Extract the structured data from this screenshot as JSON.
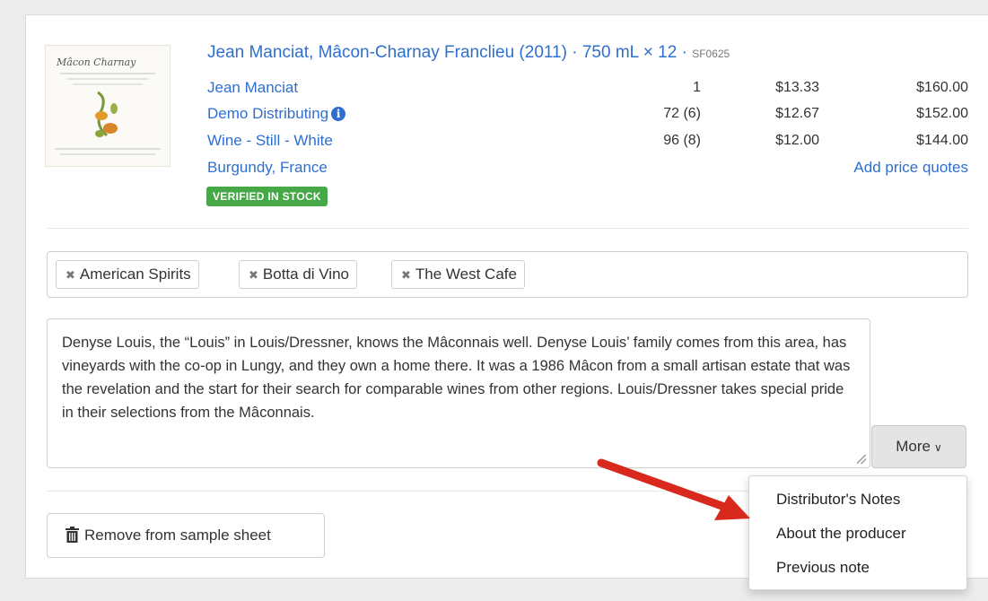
{
  "product": {
    "title": "Jean Manciat, Mâcon-Charnay Franclieu (2011) · 750 mL × 12 · ",
    "sku": "SF0625",
    "producer": "Jean Manciat",
    "distributor": "Demo Distributing",
    "category": "Wine - Still - White",
    "region": "Burgundy, France",
    "badge": "VERIFIED IN STOCK",
    "label_image_text": "Mâcon Charnay"
  },
  "pricing": {
    "rows": [
      {
        "qty": "1",
        "unit": "$13.33",
        "case": "$160.00"
      },
      {
        "qty": "72 (6)",
        "unit": "$12.67",
        "case": "$152.00"
      },
      {
        "qty": "96 (8)",
        "unit": "$12.00",
        "case": "$144.00"
      }
    ],
    "add_quotes_label": "Add price quotes"
  },
  "tags": [
    {
      "label": "American Spirits"
    },
    {
      "label": "Botta di Vino"
    },
    {
      "label": "The West Cafe"
    }
  ],
  "notes": {
    "text": "Denyse Louis, the “Louis” in Louis/Dressner, knows the Mâconnais well. Denyse Louis’ family comes from this area, has vineyards with the co-op in Lungy, and they own a home there. It was a 1986 Mâcon from a small artisan estate that was the revelation and the start for their search for comparable wines from other regions. Louis/Dressner takes special pride in their selections from the Mâconnais."
  },
  "more_button": {
    "label": "More"
  },
  "dropdown": {
    "items": [
      {
        "label": "Distributor's Notes"
      },
      {
        "label": "About the producer"
      },
      {
        "label": "Previous note"
      }
    ]
  },
  "remove_button": {
    "label": "Remove from sample sheet"
  },
  "colors": {
    "link": "#2f6fd0",
    "badge": "#47a847",
    "annotation_arrow": "#d9281c"
  }
}
